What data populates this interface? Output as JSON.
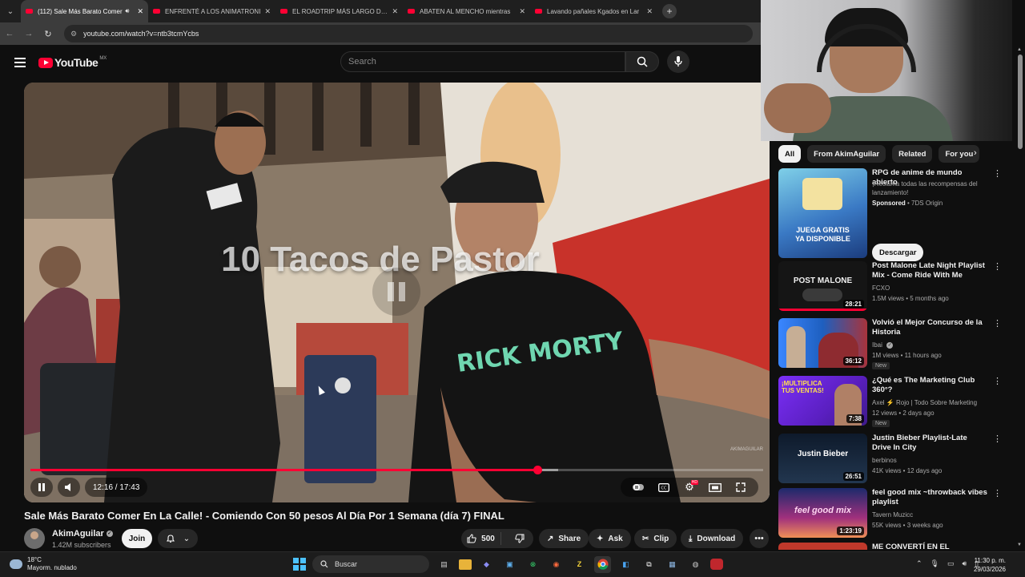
{
  "browser": {
    "tabs": [
      {
        "title": "(112) Sale Más Barato Comer",
        "active": true,
        "audio": true
      },
      {
        "title": "ENFRENTÉ A LOS ANIMATRONI",
        "active": false
      },
      {
        "title": "EL ROADTRIP MÁS LARGO DE M",
        "active": false
      },
      {
        "title": "ABATEN AL MENCHO mientras",
        "active": false
      },
      {
        "title": "Lavando pañales Kgados en Lar",
        "active": false
      }
    ],
    "url": "youtube.com/watch?v=ntb3tcmYcbs"
  },
  "header": {
    "logo_text": "YouTube",
    "country_code": "MX",
    "search_placeholder": "Search"
  },
  "player": {
    "overlay_text": "10 Tacos de Pastor",
    "time": "12:16 / 17:43",
    "progress": 0.692,
    "buffered": 0.72,
    "watermark": "AKIMAGUILAR",
    "hd_badge": "HD"
  },
  "video": {
    "title": "Sale Más Barato Comer En La Calle! - Comiendo Con 50 pesos Al Día Por 1 Semana (día 7) FINAL",
    "channel": "AkimAguilar",
    "subscribers": "1.42M subscribers",
    "join_label": "Join",
    "likes": "500",
    "share_label": "Share",
    "ask_label": "Ask",
    "clip_label": "Clip",
    "download_label": "Download"
  },
  "sidebar": {
    "chips": [
      "All",
      "From AkimAguilar",
      "Related",
      "For you"
    ],
    "ad": {
      "title": "RPG de anime de mundo abierto",
      "desc": "¡Reclama todas las recompensas del lanzamiento!",
      "sponsored": "Sponsored",
      "advertiser": "7DS Origin",
      "cta": "Descargar",
      "thumb_lines": [
        "JUEGA GRATIS",
        "YA DISPONIBLE"
      ]
    },
    "videos": [
      {
        "title": "Post Malone Late Night Playlist Mix - Come Ride With Me",
        "channel": "FCXO",
        "meta": "1.5M views • 5 months ago",
        "duration": "28:21",
        "thumb_text": "POST MALONE",
        "new": false
      },
      {
        "title": "Volvió el Mejor Concurso de la Historia",
        "channel": "Ibai",
        "meta": "1M views • 11 hours ago",
        "duration": "36:12",
        "thumb_text": "",
        "new": true
      },
      {
        "title": "¿Qué es The Marketing Club 360°?",
        "channel": "Axel ⚡ Rojo | Todo Sobre Marketing",
        "meta": "12 views • 2 days ago",
        "duration": "7:38",
        "thumb_text": "¡MULTIPLICA TUS VENTAS!",
        "new": true
      },
      {
        "title": "Justin Bieber Playlist-Late Drive In City",
        "channel": "berbinos",
        "meta": "41K views • 12 days ago",
        "duration": "26:51",
        "thumb_text": "Justin Bieber",
        "new": false
      },
      {
        "title": "feel good mix ~throwback vibes playlist",
        "channel": "Tavern Muzicc",
        "meta": "55K views • 3 weeks ago",
        "duration": "1:23:19",
        "thumb_text": "feel good mix",
        "new": false
      },
      {
        "title": "ME CONVERTÍ EN EL",
        "channel": "",
        "meta": "",
        "duration": "",
        "thumb_text": "",
        "new": false
      }
    ],
    "new_label": "New"
  },
  "taskbar": {
    "temp": "18°C",
    "weather": "Mayorm. nublado",
    "search": "Buscar",
    "time": "11:30 p. m.",
    "date": "29/03/2026"
  },
  "colors": {
    "accent": "#ff0033",
    "background": "#0f0f0f",
    "chip_bg": "#272727"
  }
}
